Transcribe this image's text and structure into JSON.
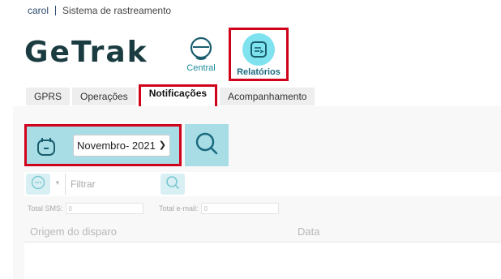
{
  "topbar": {
    "user": "carol",
    "system": "Sistema de rastreamento"
  },
  "logo": {
    "text": "GeTrak"
  },
  "nav": {
    "central_label": "Central",
    "relatorios_label": "Relatórios"
  },
  "tabs": [
    {
      "label": "GPRS",
      "active": false
    },
    {
      "label": "Operações",
      "active": false
    },
    {
      "label": "Notificações",
      "active": true
    },
    {
      "label": "Acompanhamento",
      "active": false
    }
  ],
  "filter": {
    "month_value": "Novembro- 2021",
    "filter_placeholder": "Filtrar"
  },
  "totals": {
    "sms_label": "Total SMS:",
    "sms_value": "0",
    "email_label": "Total e-mail:",
    "email_value": "0"
  },
  "table": {
    "columns": [
      "Origem do disparo",
      "Data"
    ]
  },
  "colors": {
    "accent": "#1f8a9e",
    "highlight_border": "#d0021b",
    "panel_teal": "#a9dde6",
    "logo": "#1a3c40"
  },
  "icons": {
    "central": "headset-icon",
    "relatorios": "report-icon",
    "calendar": "calendar-icon",
    "search": "search-icon",
    "more": "more-icon"
  }
}
